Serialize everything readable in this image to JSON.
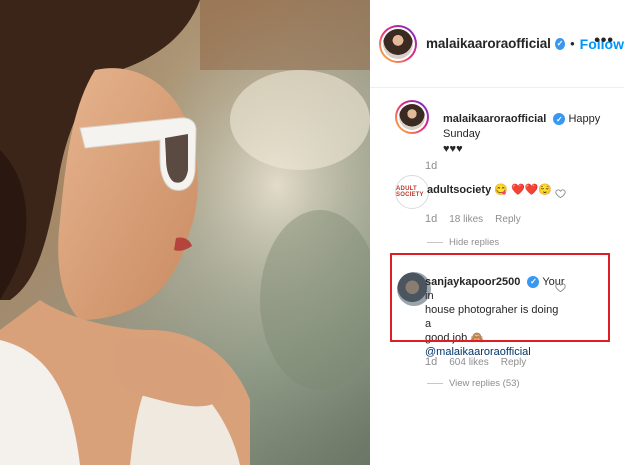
{
  "post": {
    "image_description_icon": "portrait-photo"
  },
  "header": {
    "username": "malaikaaroraofficial",
    "verified_icon": "verified-badge-icon",
    "separator": "•",
    "follow_label": "Follow",
    "more_icon": "more-options-icon",
    "more_glyph": "•••"
  },
  "caption": {
    "username": "malaikaaroraofficial",
    "text": "Happy Sunday",
    "hearts": "♥♥♥",
    "time": "1d"
  },
  "comments": [
    {
      "username": "adultsociety",
      "text": "😋 ❤️❤️😌",
      "logo_text": "ADULT SOCIETY",
      "time": "1d",
      "likes": "18 likes",
      "reply_label": "Reply",
      "replies_label": "Hide replies"
    },
    {
      "username": "sanjaykapoor2500",
      "text_line1": "Your in",
      "text_line2": "house photograher is doing a",
      "text_line3": "good job 🙈",
      "mention": "@malaikaaroraofficial",
      "time": "1d",
      "likes": "604 likes",
      "reply_label": "Reply",
      "replies_label": "View replies (53)"
    }
  ],
  "colors": {
    "follow": "#0095f6",
    "verified": "#3897f0",
    "highlight_border": "#e01c24",
    "meta_text": "#8e8e8e"
  }
}
